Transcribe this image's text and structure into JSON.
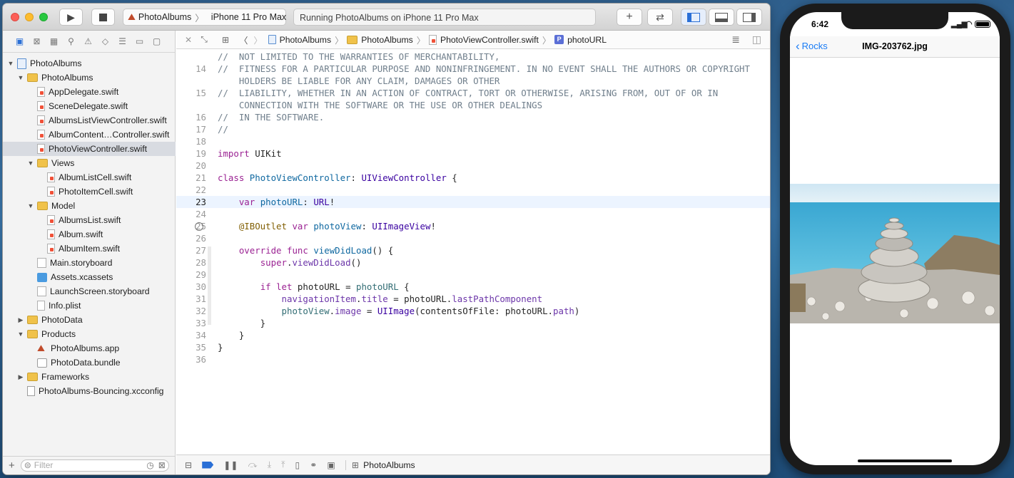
{
  "xcode": {
    "scheme": {
      "project": "PhotoAlbums",
      "device": "iPhone 11 Pro Max"
    },
    "activity_status": "Running PhotoAlbums on iPhone 11 Pro Max",
    "jumpbar": [
      "PhotoAlbums",
      "PhotoAlbums",
      "PhotoViewController.swift",
      "photoURL"
    ],
    "jumpbar_symbol_badge": "P",
    "navigator": {
      "filter_placeholder": "Filter",
      "items": [
        {
          "label": "PhotoAlbums",
          "level": 0,
          "icon": "project-icon",
          "disclosure": "open"
        },
        {
          "label": "PhotoAlbums",
          "level": 1,
          "icon": "folder-icon",
          "disclosure": "open"
        },
        {
          "label": "AppDelegate.swift",
          "level": 2,
          "icon": "swift-file-icon"
        },
        {
          "label": "SceneDelegate.swift",
          "level": 2,
          "icon": "swift-file-icon"
        },
        {
          "label": "AlbumsListViewController.swift",
          "level": 2,
          "icon": "swift-file-icon"
        },
        {
          "label": "AlbumContent…Controller.swift",
          "level": 2,
          "icon": "swift-file-icon"
        },
        {
          "label": "PhotoViewController.swift",
          "level": 2,
          "icon": "swift-file-icon",
          "selected": true
        },
        {
          "label": "Views",
          "level": 2,
          "icon": "folder-icon",
          "disclosure": "open"
        },
        {
          "label": "AlbumListCell.swift",
          "level": 3,
          "icon": "swift-file-icon"
        },
        {
          "label": "PhotoItemCell.swift",
          "level": 3,
          "icon": "swift-file-icon"
        },
        {
          "label": "Model",
          "level": 2,
          "icon": "folder-icon",
          "disclosure": "open"
        },
        {
          "label": "AlbumsList.swift",
          "level": 3,
          "icon": "swift-file-icon"
        },
        {
          "label": "Album.swift",
          "level": 3,
          "icon": "swift-file-icon"
        },
        {
          "label": "AlbumItem.swift",
          "level": 3,
          "icon": "swift-file-icon"
        },
        {
          "label": "Main.storyboard",
          "level": 2,
          "icon": "storyboard-icon"
        },
        {
          "label": "Assets.xcassets",
          "level": 2,
          "icon": "assets-icon"
        },
        {
          "label": "LaunchScreen.storyboard",
          "level": 2,
          "icon": "storyboard-icon"
        },
        {
          "label": "Info.plist",
          "level": 2,
          "icon": "plist-icon"
        },
        {
          "label": "PhotoData",
          "level": 1,
          "icon": "folder-icon",
          "disclosure": "closed"
        },
        {
          "label": "Products",
          "level": 1,
          "icon": "folder-icon",
          "disclosure": "open"
        },
        {
          "label": "PhotoAlbums.app",
          "level": 2,
          "icon": "app-icon"
        },
        {
          "label": "PhotoData.bundle",
          "level": 2,
          "icon": "bundle-icon"
        },
        {
          "label": "Frameworks",
          "level": 1,
          "icon": "folder-icon",
          "disclosure": "closed"
        },
        {
          "label": "PhotoAlbums-Bouncing.xcconfig",
          "level": 1,
          "icon": "xcconfig-icon"
        }
      ]
    },
    "editor": {
      "current_line": "23",
      "lines": [
        {
          "n": "",
          "t": "//  NOT LIMITED TO THE WARRANTIES OF MERCHANTABILITY,",
          "c": "c-com"
        },
        {
          "n": "14",
          "t": "//  FITNESS FOR A PARTICULAR PURPOSE AND NONINFRINGEMENT. IN NO EVENT SHALL THE AUTHORS OR COPYRIGHT",
          "c": "c-com"
        },
        {
          "n": "",
          "t": "    HOLDERS BE LIABLE FOR ANY CLAIM, DAMAGES OR OTHER",
          "c": "c-com"
        },
        {
          "n": "15",
          "t": "//  LIABILITY, WHETHER IN AN ACTION OF CONTRACT, TORT OR OTHERWISE, ARISING FROM, OUT OF OR IN",
          "c": "c-com"
        },
        {
          "n": "",
          "t": "    CONNECTION WITH THE SOFTWARE OR THE USE OR OTHER DEALINGS",
          "c": "c-com"
        },
        {
          "n": "16",
          "t": "//  IN THE SOFTWARE.",
          "c": "c-com"
        },
        {
          "n": "17",
          "t": "//",
          "c": "c-com"
        },
        {
          "n": "18",
          "t": ""
        },
        {
          "n": "19",
          "segs": [
            [
              "import",
              "c-kw"
            ],
            [
              " UIKit",
              ""
            ]
          ]
        },
        {
          "n": "20",
          "t": ""
        },
        {
          "n": "21",
          "segs": [
            [
              "class",
              "c-kw"
            ],
            [
              " ",
              ""
            ],
            [
              "PhotoViewController",
              "c-decl"
            ],
            [
              ": ",
              ""
            ],
            [
              "UIViewController",
              "c-type"
            ],
            [
              " {",
              ""
            ]
          ]
        },
        {
          "n": "22",
          "t": ""
        },
        {
          "n": "23",
          "segs": [
            [
              "    ",
              ""
            ],
            [
              "var",
              "c-kw"
            ],
            [
              " ",
              ""
            ],
            [
              "photoURL",
              "c-decl"
            ],
            [
              ": ",
              ""
            ],
            [
              "URL",
              "c-type"
            ],
            [
              "!",
              ""
            ]
          ]
        },
        {
          "n": "24",
          "t": ""
        },
        {
          "n": "25",
          "segs": [
            [
              "    ",
              ""
            ],
            [
              "@IBOutlet",
              "c-attr"
            ],
            [
              " ",
              ""
            ],
            [
              "var",
              "c-kw"
            ],
            [
              " ",
              ""
            ],
            [
              "photoView",
              "c-decl"
            ],
            [
              ": ",
              ""
            ],
            [
              "UIImageView",
              "c-type"
            ],
            [
              "!",
              ""
            ]
          ]
        },
        {
          "n": "26",
          "t": ""
        },
        {
          "n": "27",
          "segs": [
            [
              "    ",
              ""
            ],
            [
              "override",
              "c-kw"
            ],
            [
              " ",
              ""
            ],
            [
              "func",
              "c-kw"
            ],
            [
              " ",
              ""
            ],
            [
              "viewDidLoad",
              "c-decl"
            ],
            [
              "() {",
              ""
            ]
          ]
        },
        {
          "n": "28",
          "segs": [
            [
              "        ",
              ""
            ],
            [
              "super",
              "c-kw"
            ],
            [
              ".",
              ""
            ],
            [
              "viewDidLoad",
              "c-meth"
            ],
            [
              "()",
              ""
            ]
          ]
        },
        {
          "n": "29",
          "t": ""
        },
        {
          "n": "30",
          "segs": [
            [
              "        ",
              ""
            ],
            [
              "if",
              "c-kw"
            ],
            [
              " ",
              ""
            ],
            [
              "let",
              "c-kw"
            ],
            [
              " photoURL = ",
              ""
            ],
            [
              "photoURL",
              "c-prop"
            ],
            [
              " {",
              ""
            ]
          ]
        },
        {
          "n": "31",
          "segs": [
            [
              "            ",
              ""
            ],
            [
              "navigationItem",
              "c-meth"
            ],
            [
              ".",
              ""
            ],
            [
              "title",
              "c-meth"
            ],
            [
              " = photoURL.",
              ""
            ],
            [
              "lastPathComponent",
              "c-meth"
            ]
          ]
        },
        {
          "n": "32",
          "segs": [
            [
              "            ",
              ""
            ],
            [
              "photoView",
              "c-prop"
            ],
            [
              ".",
              ""
            ],
            [
              "image",
              "c-meth"
            ],
            [
              " = ",
              ""
            ],
            [
              "UIImage",
              "c-type"
            ],
            [
              "(contentsOfFile: photoURL.",
              ""
            ],
            [
              "path",
              "c-meth"
            ],
            [
              ")",
              ""
            ]
          ]
        },
        {
          "n": "33",
          "t": "        }"
        },
        {
          "n": "34",
          "t": "    }"
        },
        {
          "n": "35",
          "t": "}"
        },
        {
          "n": "36",
          "t": ""
        }
      ]
    },
    "debug_bar": {
      "target": "PhotoAlbums"
    }
  },
  "simulator": {
    "time": "6:42",
    "back_label": "Rocks",
    "title": "IMG-203762.jpg"
  },
  "colors": {
    "accent": "#1a7cf5",
    "keyword": "#9b2393",
    "comment": "#707f8c"
  }
}
